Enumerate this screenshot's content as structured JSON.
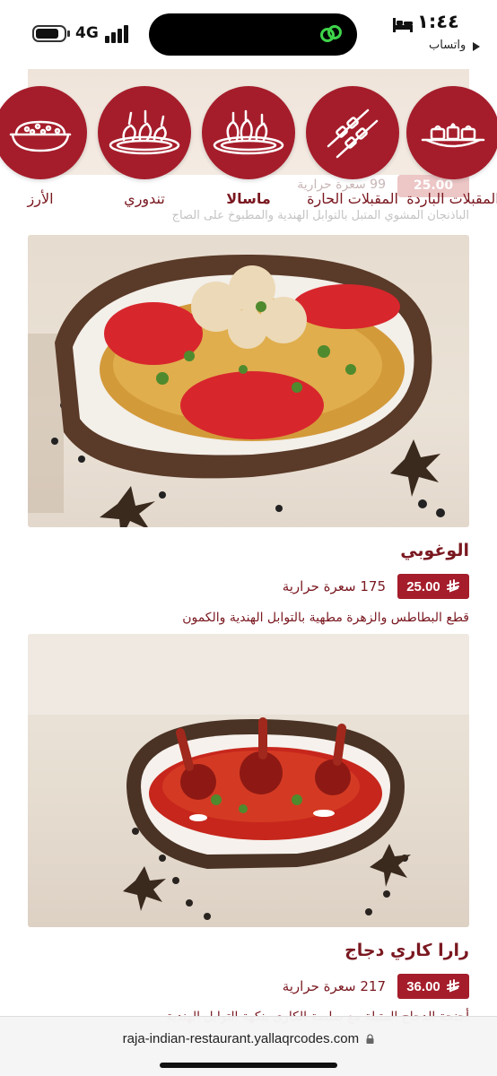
{
  "status_bar": {
    "time": "١:٤٤",
    "network": "4G",
    "back_app": "واتساب"
  },
  "background_item": {
    "price": "25.00",
    "calories": "99 سعرة حرارية",
    "description": "الباذنجان المشوي المتبل بالتوابل الهندية والمطبوخ على الصاج"
  },
  "categories": [
    {
      "label": "المقبلات الباردة",
      "icon": "cold-appetizers-icon"
    },
    {
      "label": "المقبلات الحارة",
      "icon": "skewers-icon"
    },
    {
      "label": "ماسالا",
      "icon": "masala-dish-icon",
      "active": true
    },
    {
      "label": "تندوري",
      "icon": "tandoori-dish-icon"
    },
    {
      "label": "الأرز",
      "icon": "rice-bowl-icon"
    }
  ],
  "items": [
    {
      "name": "الوغوبي",
      "price": "25.00",
      "calories": "175 سعرة حرارية",
      "description": "قطع البطاطس والزهرة مطهية بالتوابل الهندية والكمون"
    },
    {
      "name": "رارا كاري دجاج",
      "price": "36.00",
      "calories": "217 سعرة حرارية",
      "description": "أجنحة الدجاج المتبلة مع صلصة الكاري بنكهة التوابل الهندية"
    }
  ],
  "url_bar": {
    "url": "raja-indian-restaurant.yallaqrcodes.com"
  },
  "colors": {
    "brand": "#a51d2b",
    "text": "#7a1820"
  }
}
